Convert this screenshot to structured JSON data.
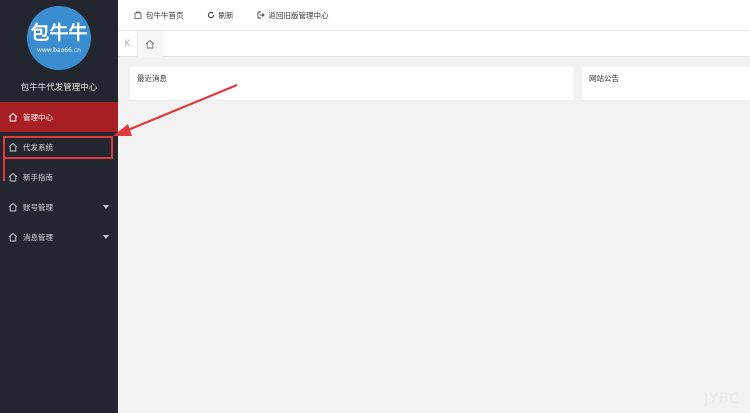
{
  "sidebar": {
    "logo_main": "包牛牛",
    "logo_url": "www.bao66.cn",
    "site_title": "包牛牛代发管理中心",
    "items": [
      {
        "label": "管理中心"
      },
      {
        "label": "代发系统"
      },
      {
        "label": "新手指南"
      },
      {
        "label": "账号管理"
      },
      {
        "label": "消息管理"
      }
    ]
  },
  "topbar": {
    "home_label": "包牛牛首页",
    "refresh_label": "刷新",
    "back_label": "返回旧版管理中心"
  },
  "tabbar": {
    "prev_symbol": "K"
  },
  "panels": {
    "messages_title": "最近消息",
    "notice_title": "网站公告"
  },
  "watermark": "JYBC",
  "colors": {
    "sidebar_bg": "#23262e",
    "active_bg": "#a71f24",
    "logo_bg": "#3a8ed0",
    "annotation": "#e0393e"
  }
}
